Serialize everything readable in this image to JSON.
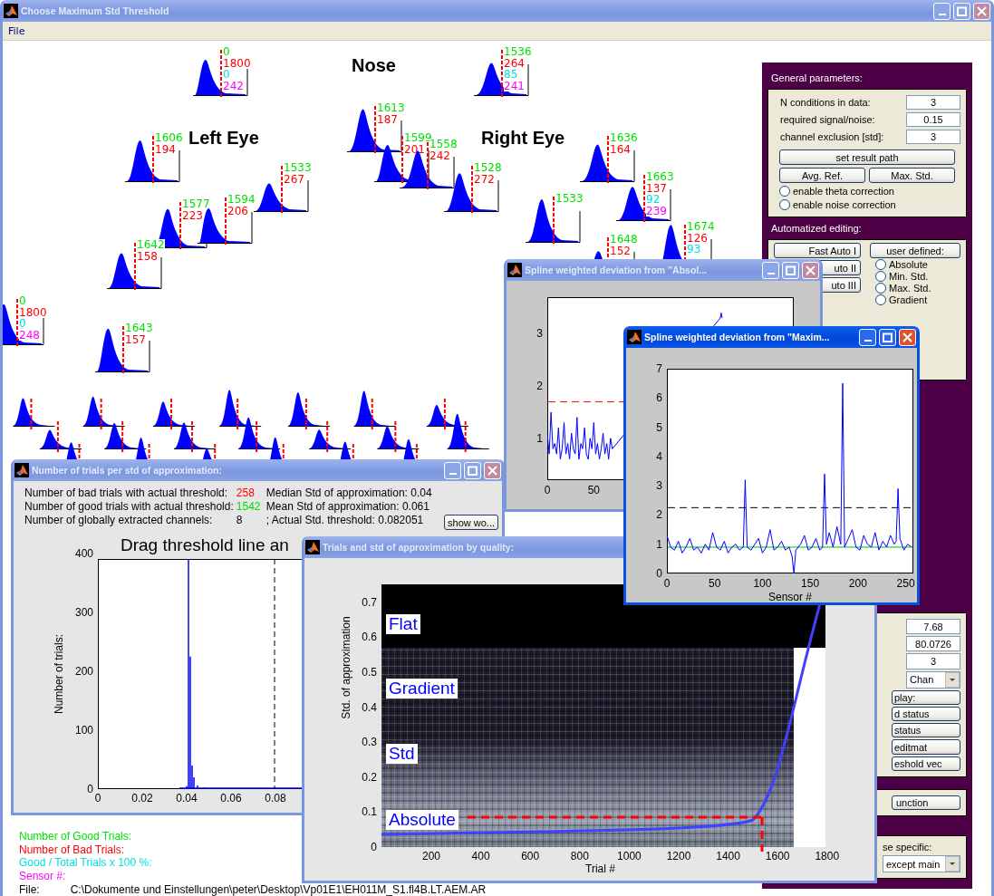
{
  "window": {
    "title": "Choose Maximum Std Threshold",
    "active": false
  },
  "menu": [
    "File"
  ],
  "head_regions": [
    "Nose",
    "Left Eye",
    "Right Eye"
  ],
  "sensors": [
    {
      "values": [
        "0",
        "1800",
        "0",
        "242"
      ]
    },
    {
      "values": [
        "1536",
        "264",
        "85",
        "241"
      ]
    },
    {
      "values": [
        "1613",
        "187"
      ]
    },
    {
      "values": [
        "1606",
        "194"
      ]
    },
    {
      "values": [
        "1599",
        "201"
      ]
    },
    {
      "values": [
        "1558",
        "242"
      ]
    },
    {
      "values": [
        "1636",
        "164"
      ]
    },
    {
      "values": [
        "1533",
        "267"
      ]
    },
    {
      "values": [
        "1528",
        "272"
      ]
    },
    {
      "values": [
        "1577",
        "223"
      ]
    },
    {
      "values": [
        "1594",
        "206"
      ]
    },
    {
      "values": [
        "1533"
      ]
    },
    {
      "values": [
        "1663",
        "137",
        "92",
        "239"
      ]
    },
    {
      "values": [
        "1642",
        "158"
      ]
    },
    {
      "values": [
        "1648",
        "152"
      ]
    },
    {
      "values": [
        "1674",
        "126",
        "93"
      ]
    },
    {
      "values": [
        "0",
        "1800",
        "0",
        "248"
      ]
    },
    {
      "values": [
        "1643",
        "157"
      ]
    }
  ],
  "legend": [
    {
      "text": "Number of Good Trials:",
      "color": "#00e000"
    },
    {
      "text": "Number of  Bad  Trials:",
      "color": "#ff0000"
    },
    {
      "text": "Good / Total Trials x 100 %:",
      "color": "#00e0e0"
    },
    {
      "text": "Sensor #:",
      "color": "#ff00ff"
    }
  ],
  "file": {
    "label": "File:",
    "path": "C:\\Dokumente und Einstellungen\\peter\\Desktop\\Vp01E1\\EH011M_S1.fl4B.LT.AEM.AR"
  },
  "panel": {
    "general_title": "General parameters:",
    "fields": [
      {
        "label": "N conditions in data:",
        "value": "3"
      },
      {
        "label": "required signal/noise:",
        "value": "0.15"
      },
      {
        "label": "channel exclusion [std]:",
        "value": "3"
      }
    ],
    "path_button": "set result path",
    "ref_buttons": [
      "Avg. Ref.",
      "Max. Std."
    ],
    "radios": [
      {
        "label": "enable theta correction",
        "checked": false
      },
      {
        "label": "enable noise correction",
        "checked": false
      }
    ],
    "editing_title": "Automatized editing:",
    "auto_buttons": [
      "Fast Auto I",
      "uto II",
      "uto III"
    ],
    "user_button": "user defined:",
    "methods": [
      {
        "label": "Absolute",
        "selected": false
      },
      {
        "label": "Min. Std.",
        "selected": false
      },
      {
        "label": "Max. Std.",
        "selected": false
      },
      {
        "label": "Gradient",
        "selected": false
      }
    ],
    "display_values": [
      "7.68",
      "80.0726",
      "3"
    ],
    "display_dropdown": "Chan",
    "display_buttons": [
      "play:",
      "d status",
      "status",
      "editmat",
      "eshold vec"
    ],
    "function_button": "unction",
    "case_label": "se specific:",
    "case_dropdown": "except main"
  },
  "dialogs": [
    {
      "kind": "histogram",
      "title": "Number of trials per std of approximation:",
      "active": false,
      "stats": [
        {
          "text": "Number of bad trials with actual threshold:",
          "count": "258",
          "color": "#ff0000",
          "extra": "Median Std of approximation: 0.04"
        },
        {
          "text": "Number of good trials with actual threshold:",
          "count": "1542",
          "color": "#00e000",
          "extra": "Mean Std of approximation:   0.061"
        },
        {
          "text": "Number of globally extracted channels:",
          "count": "8",
          "extra": ";  Actual Std. threshold: 0.082051"
        }
      ],
      "button": "show wo...",
      "heading": "Drag threshold line an",
      "ylabel": "Number of trials:",
      "yticks": [
        "400",
        "300",
        "200",
        "100",
        "0"
      ],
      "xticks": [
        "0",
        "0.02",
        "0.04",
        "0.06",
        "0.08"
      ]
    },
    {
      "kind": "quality",
      "title": "Trials and std of approximation by quality:",
      "active": false,
      "bands": [
        "Flat",
        "Gradient",
        "Std",
        "Absolute"
      ],
      "ylabel": "Std. of approximation",
      "xlabel": "Trial #",
      "yticks": [
        "0.7",
        "0.6",
        "0.5",
        "0.4",
        "0.3",
        "0.2",
        "0.1",
        "0"
      ],
      "xticks": [
        "200",
        "400",
        "600",
        "800",
        "1000",
        "1200",
        "1400",
        "1600",
        "1800"
      ]
    },
    {
      "kind": "spline",
      "title": "Spline weighted deviation from \"Absol...",
      "active": false,
      "chart_data": {
        "type": "line",
        "xlim": [
          0,
          265
        ],
        "ylim": [
          0.2,
          3.7
        ],
        "xticks": [
          0,
          50
        ],
        "yticks": [
          1,
          2,
          3
        ],
        "x": [
          0,
          2,
          4,
          6,
          8,
          10,
          12,
          14,
          16,
          18,
          20,
          22,
          24,
          26,
          28,
          30,
          32,
          34,
          36,
          38,
          40,
          42,
          44,
          46,
          48,
          50,
          52,
          54,
          56,
          58,
          60,
          62,
          64,
          66,
          68,
          70,
          186,
          187,
          188
        ],
        "series": [
          {
            "color": "#0000ff",
            "values": [
              1.1,
              0.7,
              1.5,
              0.8,
              0.9,
              0.7,
              1.2,
              0.6,
              0.8,
              1.3,
              0.7,
              0.9,
              0.6,
              1.1,
              0.8,
              0.7,
              1.4,
              0.6,
              0.9,
              0.8,
              1.2,
              0.7,
              0.6,
              1.0,
              0.8,
              1.3,
              0.7,
              0.9,
              0.6,
              0.8,
              1.1,
              0.7,
              0.9,
              0.6,
              1.0,
              0.8,
              3.3,
              3.4,
              3.3
            ]
          }
        ],
        "ref_lines": [
          {
            "axis": "y",
            "value": 1.7,
            "color": "#ff0000"
          }
        ]
      }
    },
    {
      "kind": "spline",
      "title": "Spline weighted deviation from \"Maxim...",
      "active": true,
      "chart_data": {
        "type": "line",
        "xlabel": "Sensor #",
        "xlim": [
          0,
          258
        ],
        "ylim": [
          0,
          7
        ],
        "xticks": [
          0,
          50,
          100,
          150,
          200,
          250
        ],
        "yticks": [
          0,
          1,
          2,
          3,
          4,
          5,
          6,
          7
        ],
        "x": [
          0,
          4,
          8,
          12,
          16,
          20,
          24,
          28,
          32,
          36,
          40,
          44,
          48,
          52,
          56,
          60,
          64,
          68,
          72,
          76,
          80,
          82,
          84,
          88,
          92,
          96,
          100,
          104,
          108,
          112,
          116,
          120,
          124,
          128,
          131,
          133,
          135,
          140,
          144,
          148,
          152,
          156,
          160,
          163,
          165,
          167,
          170,
          174,
          178,
          182,
          184,
          186,
          190,
          194,
          198,
          202,
          206,
          210,
          214,
          218,
          222,
          226,
          230,
          234,
          238,
          240,
          242,
          244,
          248,
          252,
          256
        ],
        "series": [
          {
            "color": "#0000ff",
            "values": [
              1.3,
              0.9,
              0.8,
              1.1,
              0.7,
              0.9,
              1.2,
              0.8,
              0.9,
              0.7,
              1.0,
              0.8,
              1.4,
              0.9,
              0.8,
              1.1,
              0.7,
              0.9,
              1.0,
              0.8,
              0.9,
              3.2,
              0.9,
              0.8,
              1.0,
              1.2,
              0.7,
              0.9,
              1.5,
              0.8,
              0.9,
              1.1,
              0.8,
              0.9,
              0.6,
              0.0,
              0.8,
              1.0,
              1.3,
              0.8,
              0.9,
              1.2,
              0.8,
              0.9,
              3.4,
              1.0,
              1.4,
              0.9,
              1.6,
              1.0,
              6.5,
              0.9,
              1.2,
              1.5,
              0.9,
              0.8,
              1.3,
              1.0,
              0.9,
              1.4,
              0.8,
              1.1,
              0.9,
              1.3,
              1.0,
              1.1,
              2.9,
              1.2,
              0.8,
              1.0,
              0.9
            ]
          }
        ],
        "ref_lines": [
          {
            "axis": "y",
            "value": 2.25,
            "color": "#000000"
          },
          {
            "axis": "y",
            "value": 0.9,
            "color": "#00c000"
          }
        ]
      }
    }
  ]
}
